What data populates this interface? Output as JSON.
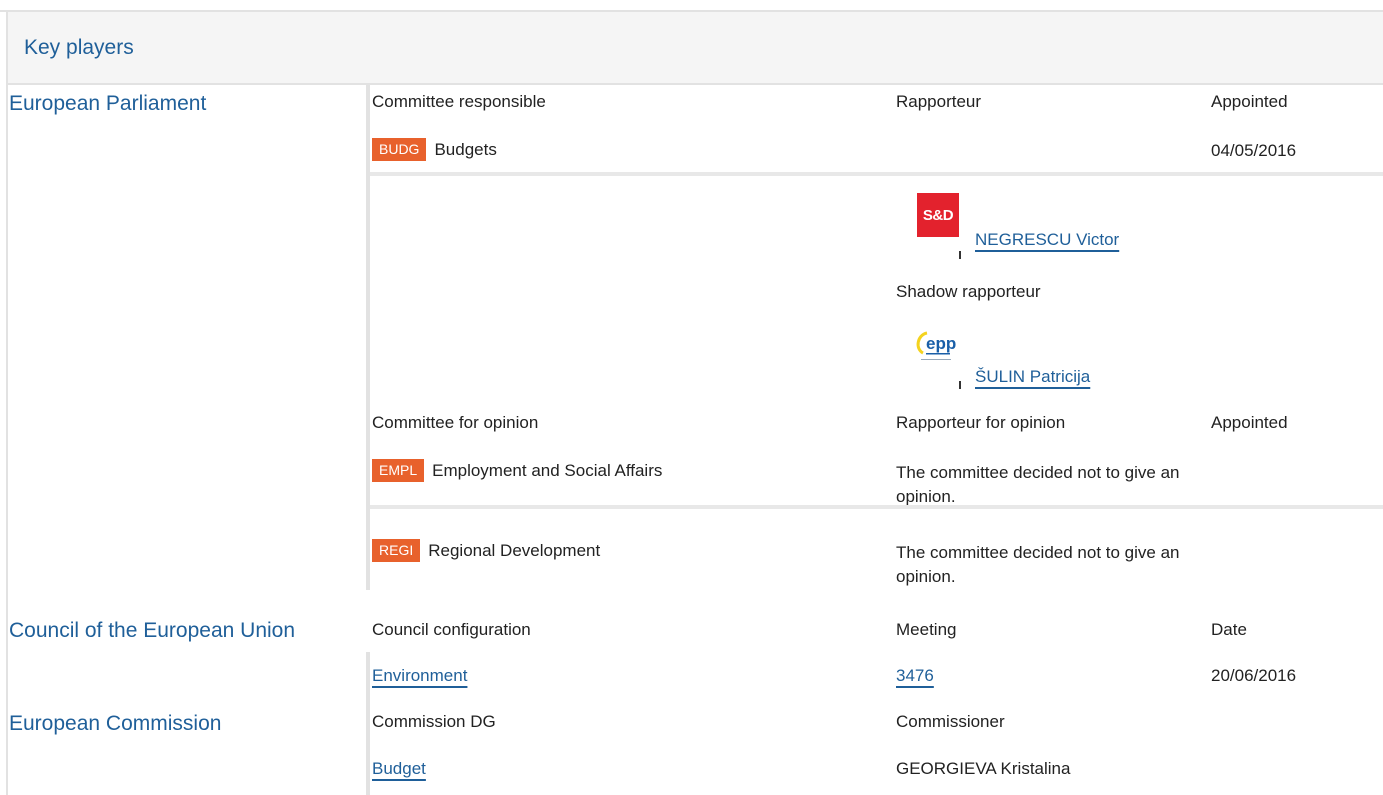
{
  "header": {
    "title": "Key players"
  },
  "parliament": {
    "name": "European Parliament",
    "columns": {
      "committee": "Committee responsible",
      "rapporteur": "Rapporteur",
      "appointed": "Appointed"
    },
    "responsible": {
      "code": "BUDG",
      "name": "Budgets",
      "appointed": "04/05/2016"
    },
    "rapporteur": {
      "group_logo": "S&D",
      "name": "NEGRESCU Victor"
    },
    "shadow_label": "Shadow rapporteur",
    "shadow": {
      "group_logo": "epp",
      "name": "ŠULIN Patricija"
    },
    "opinion_columns": {
      "committee": "Committee for opinion",
      "rapporteur": "Rapporteur for opinion",
      "appointed": "Appointed"
    },
    "opinions": [
      {
        "code": "EMPL",
        "name": "Employment and Social Affairs",
        "rapporteur": "The committee decided not to give an opinion."
      },
      {
        "code": "REGI",
        "name": "Regional Development",
        "rapporteur": "The committee decided not to give an opinion."
      }
    ]
  },
  "council": {
    "name": "Council of the European Union",
    "columns": {
      "configuration": "Council configuration",
      "meeting": "Meeting",
      "date": "Date"
    },
    "row": {
      "configuration": "Environment",
      "meeting": "3476",
      "date": "20/06/2016"
    }
  },
  "commission": {
    "name": "European Commission",
    "columns": {
      "dg": "Commission DG",
      "commissioner": "Commissioner"
    },
    "row": {
      "dg": "Budget",
      "commissioner": "GEORGIEVA Kristalina"
    }
  },
  "colors": {
    "link": "#1f5f99",
    "badge": "#e8612c",
    "sd": "#e3222d",
    "border": "#e2e2e2"
  }
}
